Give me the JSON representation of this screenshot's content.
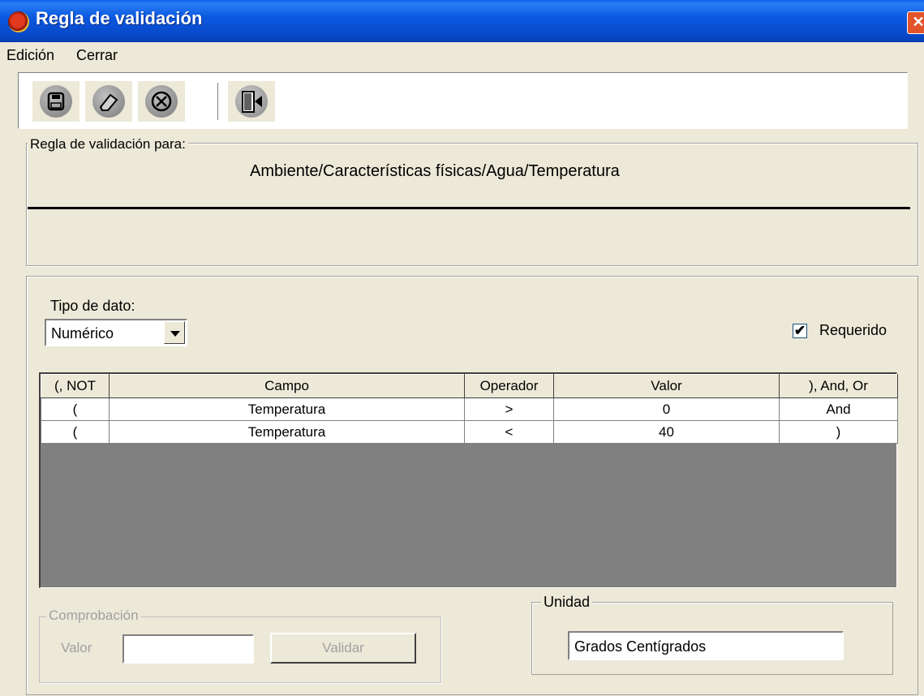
{
  "window": {
    "title": "Regla de validación",
    "close_glyph": "✕"
  },
  "menu": {
    "items": [
      "Edición",
      "Cerrar"
    ]
  },
  "toolbar": {
    "buttons": [
      "save-icon",
      "eraser-icon",
      "cancel-icon",
      "exit-door-icon"
    ]
  },
  "rule": {
    "legend": "Regla de validación para:",
    "path": "Ambiente/Características físicas/Agua/Temperatura"
  },
  "data_type": {
    "label": "Tipo de dato:",
    "value": "Numérico"
  },
  "required": {
    "label": "Requerido",
    "checked": true,
    "mark": "✔"
  },
  "grid": {
    "headers": [
      "(, NOT",
      "Campo",
      "Operador",
      "Valor",
      "), And, Or"
    ],
    "rows": [
      [
        "(",
        "Temperatura",
        ">",
        "0",
        "And"
      ],
      [
        "(",
        "Temperatura",
        "<",
        "40",
        ")"
      ]
    ]
  },
  "check": {
    "legend": "Comprobación",
    "value_label": "Valor",
    "value": "",
    "button": "Validar"
  },
  "unit": {
    "legend": "Unidad",
    "value": "Grados Centígrados"
  },
  "colors": {
    "titlebar": "#0a5fe8",
    "face": "#ece9d8",
    "grid_bg": "#808080"
  }
}
